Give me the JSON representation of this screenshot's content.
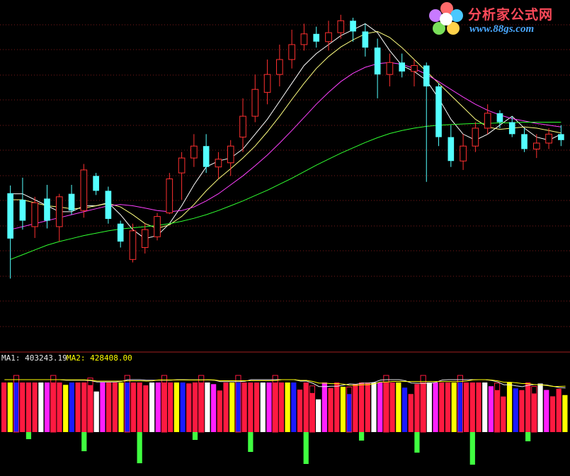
{
  "indicator": {
    "ma1_text": "MA1: 403243.19",
    "ma2_text": "MA2: 428408.00",
    "ma1_color": "#e8e8e8",
    "ma2_color": "#ffff00"
  },
  "watermark": {
    "title": "分析家公式网",
    "url": "www.88gs.com",
    "title_color": "#ff4a5a",
    "url_color": "#4aa8ff"
  },
  "colors": {
    "background": "#000000",
    "grid": "#7a1a1a",
    "separator": "#a02020",
    "up_candle": "#ff3030",
    "down_candle": "#54ffff",
    "ma_fast": "#ffffff",
    "ma_mid": "#ffff80",
    "ma_slow": "#ff40ff",
    "ma_long": "#30ff30",
    "bar_red": "#ff1a40",
    "bar_magenta": "#ff20ff",
    "bar_blue": "#1a1aff",
    "bar_white": "#ffffff",
    "bar_yellow": "#ffff00",
    "bar_green": "#40ff40"
  },
  "chart_data": {
    "type": "candlestick",
    "title": "",
    "price_axis_labels_visible": false,
    "grid": true,
    "candles": [
      [
        0.625,
        0.701,
        0.558,
        0.714,
        "down"
      ],
      [
        0.69,
        0.655,
        0.64,
        0.727,
        "down"
      ],
      [
        0.645,
        0.685,
        0.626,
        0.695,
        "up"
      ],
      [
        0.692,
        0.655,
        0.642,
        0.715,
        "down"
      ],
      [
        0.645,
        0.695,
        0.62,
        0.7,
        "up"
      ],
      [
        0.7,
        0.672,
        0.665,
        0.715,
        "down"
      ],
      [
        0.672,
        0.74,
        0.66,
        0.75,
        "up"
      ],
      [
        0.73,
        0.705,
        0.698,
        0.735,
        "down"
      ],
      [
        0.705,
        0.658,
        0.65,
        0.712,
        "down"
      ],
      [
        0.65,
        0.62,
        0.61,
        0.655,
        "down"
      ],
      [
        0.59,
        0.638,
        0.585,
        0.65,
        "up"
      ],
      [
        0.61,
        0.64,
        0.6,
        0.65,
        "up"
      ],
      [
        0.628,
        0.662,
        0.622,
        0.668,
        "up"
      ],
      [
        0.668,
        0.725,
        0.666,
        0.735,
        "up"
      ],
      [
        0.735,
        0.76,
        0.69,
        0.77,
        "up"
      ],
      [
        0.76,
        0.78,
        0.745,
        0.8,
        "up"
      ],
      [
        0.78,
        0.745,
        0.735,
        0.8,
        "down"
      ],
      [
        0.745,
        0.758,
        0.725,
        0.77,
        "up"
      ],
      [
        0.752,
        0.78,
        0.73,
        0.79,
        "up"
      ],
      [
        0.795,
        0.83,
        0.77,
        0.86,
        "up"
      ],
      [
        0.83,
        0.875,
        0.82,
        0.9,
        "up"
      ],
      [
        0.87,
        0.9,
        0.85,
        0.925,
        "up"
      ],
      [
        0.9,
        0.925,
        0.88,
        0.95,
        "up"
      ],
      [
        0.925,
        0.95,
        0.91,
        0.975,
        "up"
      ],
      [
        0.95,
        0.968,
        0.94,
        0.985,
        "up"
      ],
      [
        0.968,
        0.955,
        0.945,
        0.98,
        "down"
      ],
      [
        0.955,
        0.97,
        0.94,
        0.99,
        "up"
      ],
      [
        0.97,
        0.99,
        0.96,
        1.0,
        "up"
      ],
      [
        0.99,
        0.972,
        0.955,
        0.995,
        "down"
      ],
      [
        0.972,
        0.945,
        0.93,
        0.985,
        "down"
      ],
      [
        0.945,
        0.9,
        0.86,
        0.96,
        "down"
      ],
      [
        0.9,
        0.92,
        0.88,
        0.935,
        "up"
      ],
      [
        0.92,
        0.905,
        0.895,
        0.935,
        "down"
      ],
      [
        0.905,
        0.915,
        0.88,
        0.925,
        "up"
      ],
      [
        0.915,
        0.88,
        0.72,
        0.92,
        "down"
      ],
      [
        0.88,
        0.795,
        0.78,
        0.885,
        "down"
      ],
      [
        0.795,
        0.755,
        0.745,
        0.815,
        "down"
      ],
      [
        0.755,
        0.78,
        0.74,
        0.8,
        "up"
      ],
      [
        0.78,
        0.81,
        0.77,
        0.82,
        "up"
      ],
      [
        0.81,
        0.835,
        0.8,
        0.85,
        "up"
      ],
      [
        0.835,
        0.82,
        0.81,
        0.84,
        "down"
      ],
      [
        0.82,
        0.8,
        0.795,
        0.83,
        "down"
      ],
      [
        0.8,
        0.775,
        0.77,
        0.81,
        "down"
      ],
      [
        0.775,
        0.785,
        0.76,
        0.8,
        "up"
      ],
      [
        0.785,
        0.8,
        0.775,
        0.81,
        "up"
      ],
      [
        0.8,
        0.79,
        0.78,
        0.815,
        "down"
      ]
    ],
    "ma_lines": [
      {
        "values": [
          0.7,
          0.7,
          0.69,
          0.68,
          0.67,
          0.67,
          0.68,
          0.68,
          0.685,
          0.665,
          0.64,
          0.625,
          0.63,
          0.65,
          0.68,
          0.715,
          0.745,
          0.755,
          0.76,
          0.775,
          0.8,
          0.825,
          0.855,
          0.885,
          0.915,
          0.935,
          0.95,
          0.965,
          0.975,
          0.985,
          0.97,
          0.94,
          0.915,
          0.905,
          0.89,
          0.86,
          0.825,
          0.8,
          0.79,
          0.8,
          0.815,
          0.83,
          0.81,
          0.795,
          0.79,
          0.8
        ]
      },
      {
        "values": [
          0.69,
          0.69,
          0.685,
          0.68,
          0.678,
          0.675,
          0.676,
          0.68,
          0.684,
          0.678,
          0.665,
          0.65,
          0.642,
          0.648,
          0.662,
          0.682,
          0.705,
          0.725,
          0.742,
          0.76,
          0.78,
          0.804,
          0.83,
          0.858,
          0.885,
          0.91,
          0.93,
          0.946,
          0.958,
          0.968,
          0.972,
          0.962,
          0.945,
          0.925,
          0.905,
          0.885,
          0.865,
          0.845,
          0.825,
          0.812,
          0.808,
          0.81,
          0.812,
          0.81,
          0.806,
          0.802
        ]
      },
      {
        "values": [
          0.64,
          0.645,
          0.65,
          0.655,
          0.66,
          0.665,
          0.67,
          0.675,
          0.68,
          0.682,
          0.68,
          0.676,
          0.672,
          0.67,
          0.672,
          0.678,
          0.688,
          0.7,
          0.715,
          0.73,
          0.747,
          0.765,
          0.785,
          0.806,
          0.828,
          0.85,
          0.87,
          0.888,
          0.902,
          0.912,
          0.918,
          0.92,
          0.917,
          0.91,
          0.9,
          0.888,
          0.875,
          0.862,
          0.85,
          0.84,
          0.832,
          0.826,
          0.822,
          0.818,
          0.815,
          0.812
        ]
      },
      {
        "values": [
          0.59,
          0.598,
          0.606,
          0.614,
          0.62,
          0.625,
          0.63,
          0.634,
          0.638,
          0.641,
          0.643,
          0.645,
          0.647,
          0.65,
          0.654,
          0.659,
          0.665,
          0.672,
          0.68,
          0.688,
          0.697,
          0.706,
          0.716,
          0.726,
          0.737,
          0.748,
          0.758,
          0.768,
          0.777,
          0.786,
          0.794,
          0.801,
          0.806,
          0.81,
          0.813,
          0.815,
          0.816,
          0.817,
          0.818,
          0.818,
          0.819,
          0.819,
          0.82,
          0.82,
          0.82,
          0.82
        ]
      }
    ],
    "volume": {
      "ma1": 403243.19,
      "ma2": 428408.0
    }
  }
}
